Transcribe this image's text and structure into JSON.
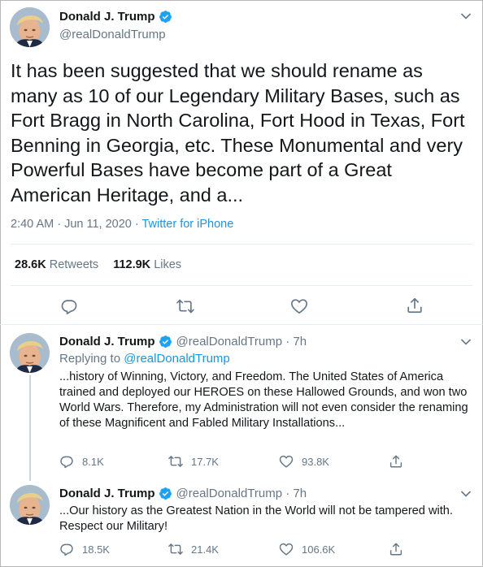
{
  "main_tweet": {
    "author_name": "Donald J. Trump",
    "handle": "@realDonaldTrump",
    "text": "It has been suggested that we should rename as many as 10 of our Legendary Military Bases, such as Fort Bragg in North Carolina, Fort Hood in Texas, Fort Benning in Georgia, etc. These Monumental and very Powerful Bases have become part of a Great American Heritage, and a...",
    "time": "2:40 AM · Jun 11, 2020 · ",
    "source": "Twitter for iPhone",
    "retweets_count": "28.6K",
    "retweets_label": "Retweets",
    "likes_count": "112.9K",
    "likes_label": "Likes"
  },
  "replies": [
    {
      "author_name": "Donald J. Trump",
      "handle_time": "@realDonaldTrump · 7h",
      "replying_prefix": "Replying to ",
      "replying_to": "@realDonaldTrump",
      "text": "...history of Winning, Victory, and Freedom. The United States of America trained and deployed our HEROES on these Hallowed Grounds, and won two World Wars. Therefore, my Administration will not even consider the renaming of these Magnificent and Fabled Military Installations...",
      "replies_count": "8.1K",
      "retweets_count": "17.7K",
      "likes_count": "93.8K"
    },
    {
      "author_name": "Donald J. Trump",
      "handle_time": "@realDonaldTrump · 7h",
      "text": "...Our history as the Greatest Nation in the World will not be tampered with. Respect our Military!",
      "replies_count": "18.5K",
      "retweets_count": "21.4K",
      "likes_count": "106.6K"
    }
  ],
  "icons": {
    "verified": "verified-badge-icon",
    "menu": "chevron-down-icon",
    "reply": "reply-icon",
    "retweet": "retweet-icon",
    "like": "heart-icon",
    "share": "share-icon"
  },
  "colors": {
    "accent": "#1b95e0",
    "verified": "#1da1f2",
    "muted": "#657786",
    "text": "#14171a",
    "divider": "#e6ecf0"
  }
}
